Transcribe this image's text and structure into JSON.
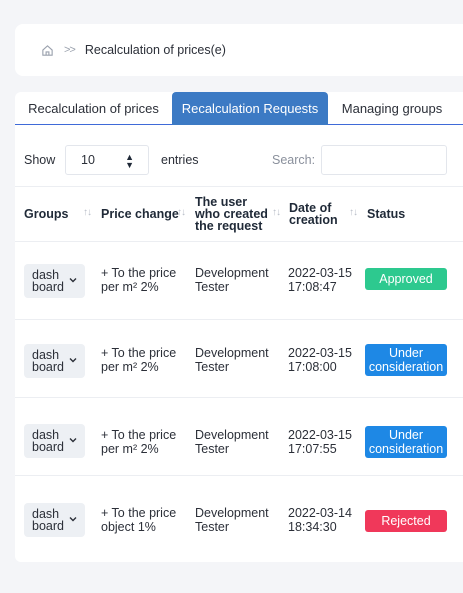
{
  "breadcrumb": {
    "home_icon": "home-icon",
    "separator": ">>",
    "current": "Recalculation of prices(e)"
  },
  "tabs": [
    {
      "label": "Recalculation of prices",
      "active": false
    },
    {
      "label": "Recalculation Requests",
      "active": true
    },
    {
      "label": "Managing groups",
      "active": false
    }
  ],
  "controls": {
    "show_label": "Show",
    "page_size": "10",
    "entries_label": "entries",
    "search_label": "Search:",
    "search_value": ""
  },
  "table": {
    "columns": [
      "Groups",
      "Price change",
      "The user who created the request",
      "Date of creation",
      "Status"
    ],
    "rows": [
      {
        "group": "dash board",
        "price_change": "+ To the price per m² 2%",
        "user": "Development Tester",
        "date": "2022-03-15",
        "time": "17:08:47",
        "status": "Approved"
      },
      {
        "group": "dash board",
        "price_change": "+ To the price per m² 2%",
        "user": "Development Tester",
        "date": "2022-03-15",
        "time": "17:08:00",
        "status": "Under consideration"
      },
      {
        "group": "dash board",
        "price_change": "+ To the price per m² 2%",
        "user": "Development Tester",
        "date": "2022-03-15",
        "time": "17:07:55",
        "status": "Under consideration"
      },
      {
        "group": "dash board",
        "price_change": "+ To the price object 1%",
        "user": "Development Tester",
        "date": "2022-03-14",
        "time": "18:34:30",
        "status": "Rejected"
      }
    ]
  },
  "colors": {
    "accent": "#3c7ac4",
    "approved": "#2dc98f",
    "under_consideration": "#1e88e5",
    "rejected": "#f0385a"
  }
}
